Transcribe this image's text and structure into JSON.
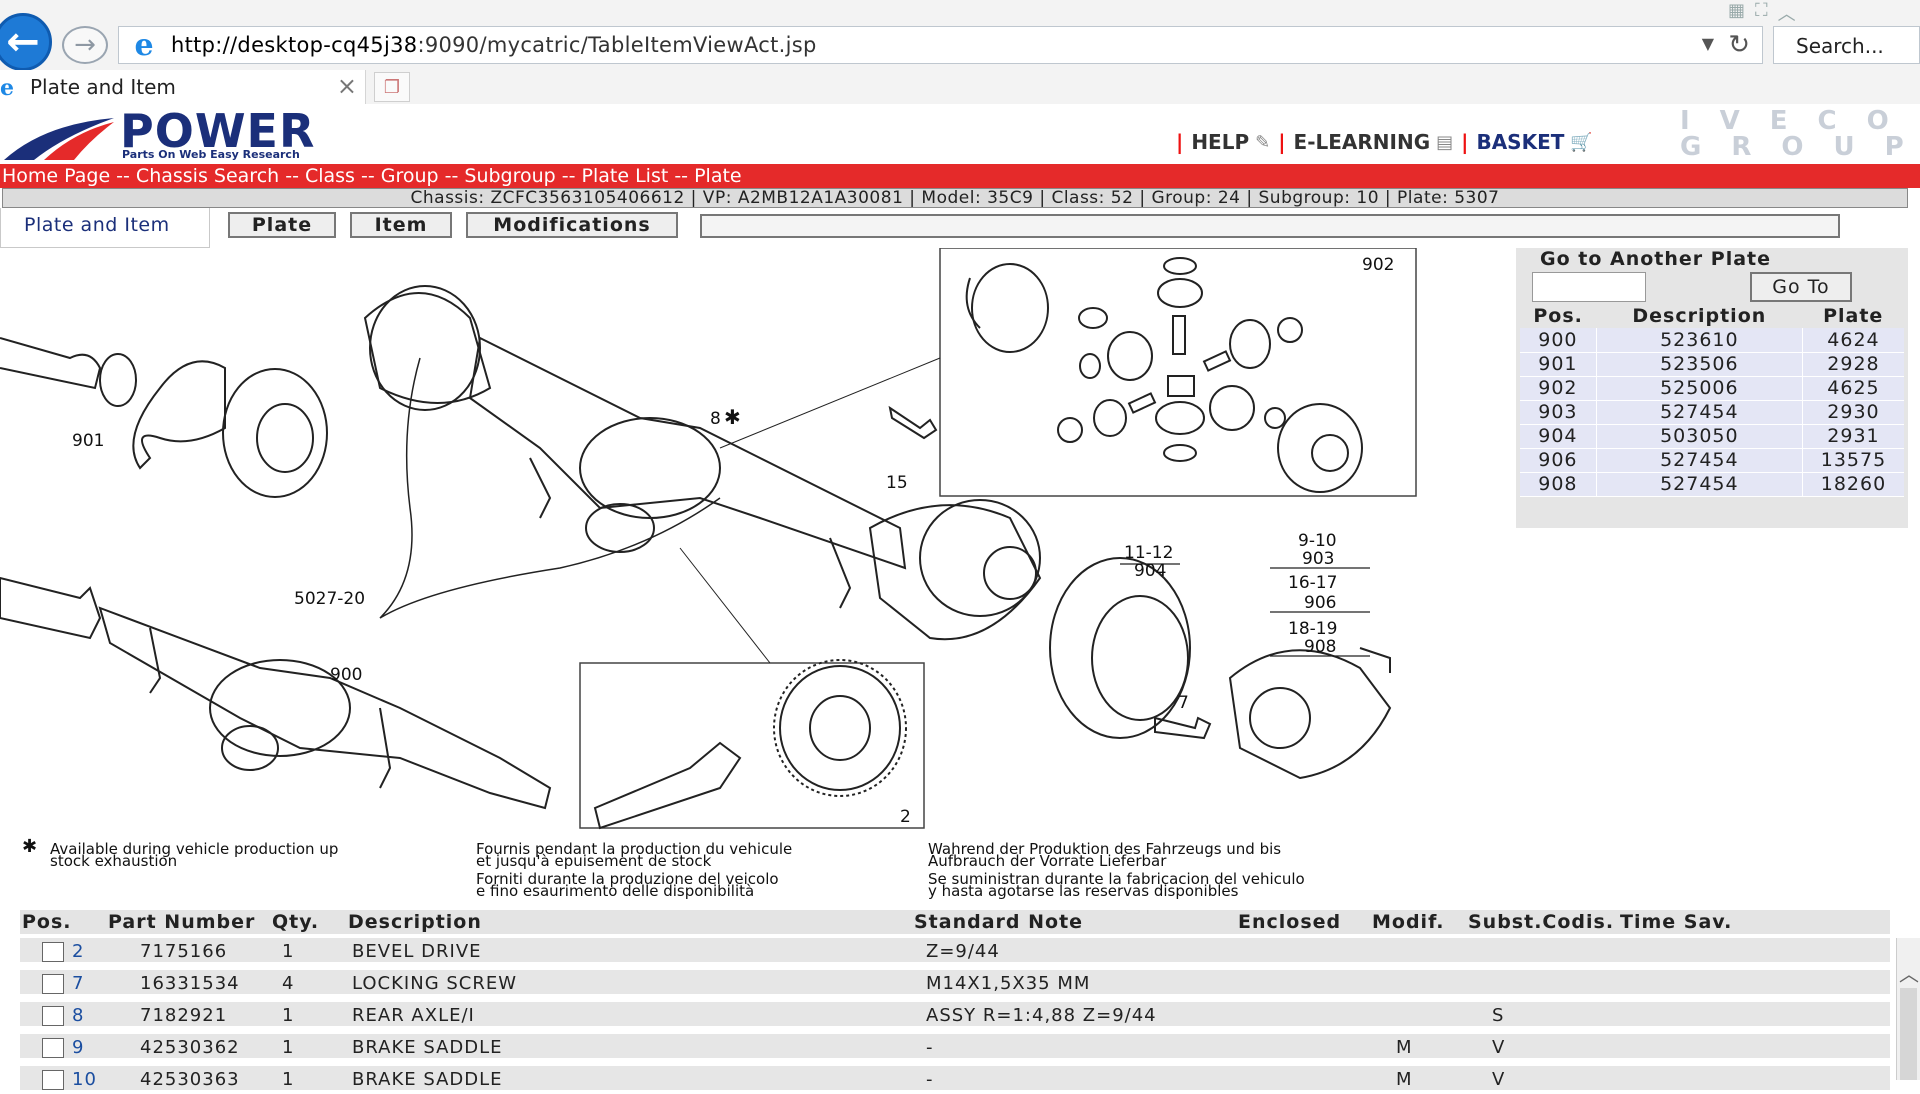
{
  "browser": {
    "url_host": "http://desktop-cq45j38",
    "url_rest": ":9090/mycatric/TableItemViewAct.jsp",
    "search_placeholder": "Search...",
    "tab_title": "Plate and Item"
  },
  "header": {
    "logo_text": "POWER",
    "logo_tagline": "Parts On Web Easy Research",
    "links": {
      "help": "HELP",
      "elearning": "E-LEARNING",
      "basket": "BASKET"
    },
    "brand_top": "IVECO",
    "brand_bottom": "GROUP"
  },
  "breadcrumb": "Home Page -- Chassis Search -- Class -- Group -- Subgroup -- Plate List -- Plate",
  "info_bar": "Chassis: ZCFC3563105406612 | VP: A2MB12A1A30081 | Model: 35C9 | Class: 52 | Group: 24 | Subgroup: 10 | Plate: 5307",
  "tabs": {
    "plate_and_item": "Plate and Item",
    "plate": "Plate",
    "item": "Item",
    "modifications": "Modifications"
  },
  "drawing_labels": {
    "l901": "901",
    "l902": "902",
    "l8": "8",
    "l15": "15",
    "l5027": "5027-20",
    "l900": "900",
    "l2": "2",
    "l7": "7",
    "l11_12": "11-12",
    "l904": "904",
    "l9_10": "9-10",
    "l903": "903",
    "l16_17": "16-17",
    "l906": "906",
    "l18_19": "18-19",
    "l908": "908"
  },
  "goto": {
    "title": "Go to Another Plate",
    "button": "Go To",
    "columns": [
      "Pos.",
      "Description",
      "Plate"
    ],
    "rows": [
      {
        "pos": "900",
        "desc": "523610",
        "plate": "4624"
      },
      {
        "pos": "901",
        "desc": "523506",
        "plate": "2928"
      },
      {
        "pos": "902",
        "desc": "525006",
        "plate": "4625"
      },
      {
        "pos": "903",
        "desc": "527454",
        "plate": "2930"
      },
      {
        "pos": "904",
        "desc": "503050",
        "plate": "2931"
      },
      {
        "pos": "906",
        "desc": "527454",
        "plate": "13575"
      },
      {
        "pos": "908",
        "desc": "527454",
        "plate": "18260"
      }
    ]
  },
  "legend": {
    "en1": "Available during vehicle production up",
    "en2": "stock exhaustion",
    "fr1": "Fournis pendant la production du vehicule",
    "fr2": "et jusqu'à epuisement de stock",
    "it1": "Forniti durante la produzione del veicolo",
    "it2": "e fino esaurimento delle disponibilità",
    "de1": "Wahrend der Produktion des Fahrzeugs und bis",
    "de2": "Aufbrauch der Vorrate Lieferbar",
    "es1": "Se suministran durante la fabricacion del vehiculo",
    "es2": "y hasta agotarse las reservas disponibles"
  },
  "parts": {
    "columns": {
      "pos": "Pos.",
      "part": "Part Number",
      "qty": "Qty.",
      "desc": "Description",
      "note": "Standard Note",
      "enclosed": "Enclosed",
      "modif": "Modif.",
      "subst": "Subst.Codis.",
      "time": "Time Sav."
    },
    "rows": [
      {
        "pos": "2",
        "part": "7175166",
        "qty": "1",
        "desc": "BEVEL DRIVE",
        "note": "Z=9/44",
        "modif": "",
        "subst": ""
      },
      {
        "pos": "7",
        "part": "16331534",
        "qty": "4",
        "desc": "LOCKING SCREW",
        "note": "M14X1,5X35 MM",
        "modif": "",
        "subst": ""
      },
      {
        "pos": "8",
        "part": "7182921",
        "qty": "1",
        "desc": "REAR AXLE/I",
        "note": "ASSY R=1:4,88 Z=9/44",
        "modif": "",
        "subst": "S"
      },
      {
        "pos": "9",
        "part": "42530362",
        "qty": "1",
        "desc": "BRAKE SADDLE",
        "note": "-",
        "modif": "M",
        "subst": "V"
      },
      {
        "pos": "10",
        "part": "42530363",
        "qty": "1",
        "desc": "BRAKE SADDLE",
        "note": "-",
        "modif": "M",
        "subst": "V"
      }
    ]
  },
  "colors": {
    "breadcrumb_bg": "#e52a2a",
    "brand_blue": "#1b2f7a",
    "link_blue": "#1b4ea0"
  }
}
